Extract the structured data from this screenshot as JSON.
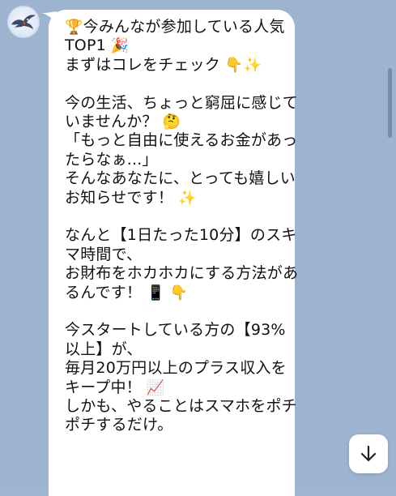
{
  "chat": {
    "sender_avatar_icon": "bird-avatar-icon",
    "message_lines": [
      {
        "text": "今みんなが参加している人気",
        "lead_emoji": "🏆"
      },
      {
        "text": "TOP1",
        "trail_emoji": "🎉"
      },
      {
        "text": "まずはコレをチェック",
        "trail_emoji": "👇✨"
      },
      {
        "text": ""
      },
      {
        "text": "今の生活、ちょっと窮屈に感じて"
      },
      {
        "text": "いませんか？",
        "trail_emoji": "🤔"
      },
      {
        "text": "「もっと自由に使えるお金があっ"
      },
      {
        "text": "たらなぁ...」"
      },
      {
        "text": "そんなあなたに、とっても嬉しい"
      },
      {
        "text": "お知らせです！",
        "trail_emoji": "✨"
      },
      {
        "text": ""
      },
      {
        "text": "なんと【1日たった10分】のスキ"
      },
      {
        "text": "マ時間で、"
      },
      {
        "text": "お財布をホカホカにする方法があ"
      },
      {
        "text": "るんです！",
        "trail_emoji": "📱 👇"
      },
      {
        "text": ""
      },
      {
        "text": "今スタートしている方の【93%"
      },
      {
        "text": "以上】が、"
      },
      {
        "text": "毎月20万円以上のプラス収入を"
      },
      {
        "text": "キープ中！",
        "trail_emoji": "📈"
      },
      {
        "text": "しかも、やることはスマホをポチ"
      },
      {
        "text": "ポチするだけ。"
      },
      {
        "text": ""
      }
    ]
  },
  "scroll_button": {
    "icon": "arrow-down-icon"
  },
  "colors": {
    "chat_background": "#9db4d1",
    "bubble": "#ffffff",
    "text": "#111111"
  }
}
